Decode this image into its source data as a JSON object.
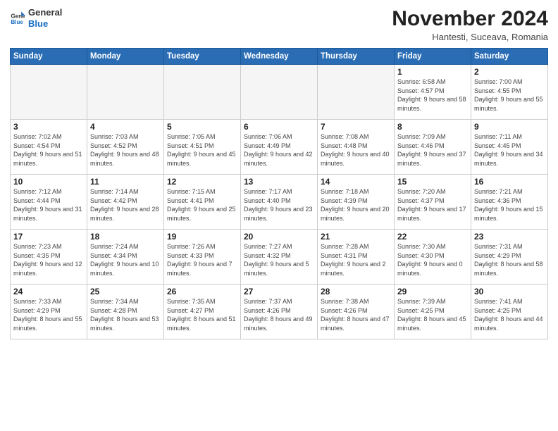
{
  "logo": {
    "general": "General",
    "blue": "Blue"
  },
  "title": "November 2024",
  "location": "Hantesti, Suceava, Romania",
  "headers": [
    "Sunday",
    "Monday",
    "Tuesday",
    "Wednesday",
    "Thursday",
    "Friday",
    "Saturday"
  ],
  "weeks": [
    [
      {
        "day": "",
        "info": ""
      },
      {
        "day": "",
        "info": ""
      },
      {
        "day": "",
        "info": ""
      },
      {
        "day": "",
        "info": ""
      },
      {
        "day": "",
        "info": ""
      },
      {
        "day": "1",
        "info": "Sunrise: 6:58 AM\nSunset: 4:57 PM\nDaylight: 9 hours and 58 minutes."
      },
      {
        "day": "2",
        "info": "Sunrise: 7:00 AM\nSunset: 4:55 PM\nDaylight: 9 hours and 55 minutes."
      }
    ],
    [
      {
        "day": "3",
        "info": "Sunrise: 7:02 AM\nSunset: 4:54 PM\nDaylight: 9 hours and 51 minutes."
      },
      {
        "day": "4",
        "info": "Sunrise: 7:03 AM\nSunset: 4:52 PM\nDaylight: 9 hours and 48 minutes."
      },
      {
        "day": "5",
        "info": "Sunrise: 7:05 AM\nSunset: 4:51 PM\nDaylight: 9 hours and 45 minutes."
      },
      {
        "day": "6",
        "info": "Sunrise: 7:06 AM\nSunset: 4:49 PM\nDaylight: 9 hours and 42 minutes."
      },
      {
        "day": "7",
        "info": "Sunrise: 7:08 AM\nSunset: 4:48 PM\nDaylight: 9 hours and 40 minutes."
      },
      {
        "day": "8",
        "info": "Sunrise: 7:09 AM\nSunset: 4:46 PM\nDaylight: 9 hours and 37 minutes."
      },
      {
        "day": "9",
        "info": "Sunrise: 7:11 AM\nSunset: 4:45 PM\nDaylight: 9 hours and 34 minutes."
      }
    ],
    [
      {
        "day": "10",
        "info": "Sunrise: 7:12 AM\nSunset: 4:44 PM\nDaylight: 9 hours and 31 minutes."
      },
      {
        "day": "11",
        "info": "Sunrise: 7:14 AM\nSunset: 4:42 PM\nDaylight: 9 hours and 28 minutes."
      },
      {
        "day": "12",
        "info": "Sunrise: 7:15 AM\nSunset: 4:41 PM\nDaylight: 9 hours and 25 minutes."
      },
      {
        "day": "13",
        "info": "Sunrise: 7:17 AM\nSunset: 4:40 PM\nDaylight: 9 hours and 23 minutes."
      },
      {
        "day": "14",
        "info": "Sunrise: 7:18 AM\nSunset: 4:39 PM\nDaylight: 9 hours and 20 minutes."
      },
      {
        "day": "15",
        "info": "Sunrise: 7:20 AM\nSunset: 4:37 PM\nDaylight: 9 hours and 17 minutes."
      },
      {
        "day": "16",
        "info": "Sunrise: 7:21 AM\nSunset: 4:36 PM\nDaylight: 9 hours and 15 minutes."
      }
    ],
    [
      {
        "day": "17",
        "info": "Sunrise: 7:23 AM\nSunset: 4:35 PM\nDaylight: 9 hours and 12 minutes."
      },
      {
        "day": "18",
        "info": "Sunrise: 7:24 AM\nSunset: 4:34 PM\nDaylight: 9 hours and 10 minutes."
      },
      {
        "day": "19",
        "info": "Sunrise: 7:26 AM\nSunset: 4:33 PM\nDaylight: 9 hours and 7 minutes."
      },
      {
        "day": "20",
        "info": "Sunrise: 7:27 AM\nSunset: 4:32 PM\nDaylight: 9 hours and 5 minutes."
      },
      {
        "day": "21",
        "info": "Sunrise: 7:28 AM\nSunset: 4:31 PM\nDaylight: 9 hours and 2 minutes."
      },
      {
        "day": "22",
        "info": "Sunrise: 7:30 AM\nSunset: 4:30 PM\nDaylight: 9 hours and 0 minutes."
      },
      {
        "day": "23",
        "info": "Sunrise: 7:31 AM\nSunset: 4:29 PM\nDaylight: 8 hours and 58 minutes."
      }
    ],
    [
      {
        "day": "24",
        "info": "Sunrise: 7:33 AM\nSunset: 4:29 PM\nDaylight: 8 hours and 55 minutes."
      },
      {
        "day": "25",
        "info": "Sunrise: 7:34 AM\nSunset: 4:28 PM\nDaylight: 8 hours and 53 minutes."
      },
      {
        "day": "26",
        "info": "Sunrise: 7:35 AM\nSunset: 4:27 PM\nDaylight: 8 hours and 51 minutes."
      },
      {
        "day": "27",
        "info": "Sunrise: 7:37 AM\nSunset: 4:26 PM\nDaylight: 8 hours and 49 minutes."
      },
      {
        "day": "28",
        "info": "Sunrise: 7:38 AM\nSunset: 4:26 PM\nDaylight: 8 hours and 47 minutes."
      },
      {
        "day": "29",
        "info": "Sunrise: 7:39 AM\nSunset: 4:25 PM\nDaylight: 8 hours and 45 minutes."
      },
      {
        "day": "30",
        "info": "Sunrise: 7:41 AM\nSunset: 4:25 PM\nDaylight: 8 hours and 44 minutes."
      }
    ]
  ]
}
